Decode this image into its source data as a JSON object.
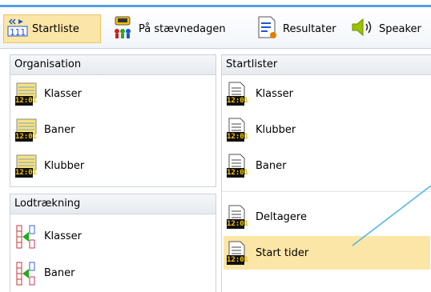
{
  "toolbar": {
    "items": [
      {
        "label": "Startliste",
        "icon": "startlist-icon",
        "active": true
      },
      {
        "label": "På stævnedagen",
        "icon": "race-day-icon",
        "active": false
      },
      {
        "label": "Resultater",
        "icon": "results-icon",
        "active": false
      },
      {
        "label": "Speaker",
        "icon": "speaker-icon",
        "active": false
      }
    ]
  },
  "clock_text": "12:01",
  "panels": {
    "organisation": {
      "title": "Organisation",
      "items": [
        "Klasser",
        "Baner",
        "Klubber"
      ]
    },
    "lodtraekning": {
      "title": "Lodtrækning",
      "items": [
        "Klasser",
        "Baner"
      ]
    },
    "startlister": {
      "title": "Startlister",
      "items": [
        "Klasser",
        "Klubber",
        "Baner"
      ],
      "items2": [
        "Deltagere",
        "Start tider"
      ],
      "selected": "Start tider"
    }
  },
  "colors": {
    "accent_blue": "#4f9fe6",
    "selection": "#fbe6a7",
    "panel_border": "#c9d2dc"
  }
}
